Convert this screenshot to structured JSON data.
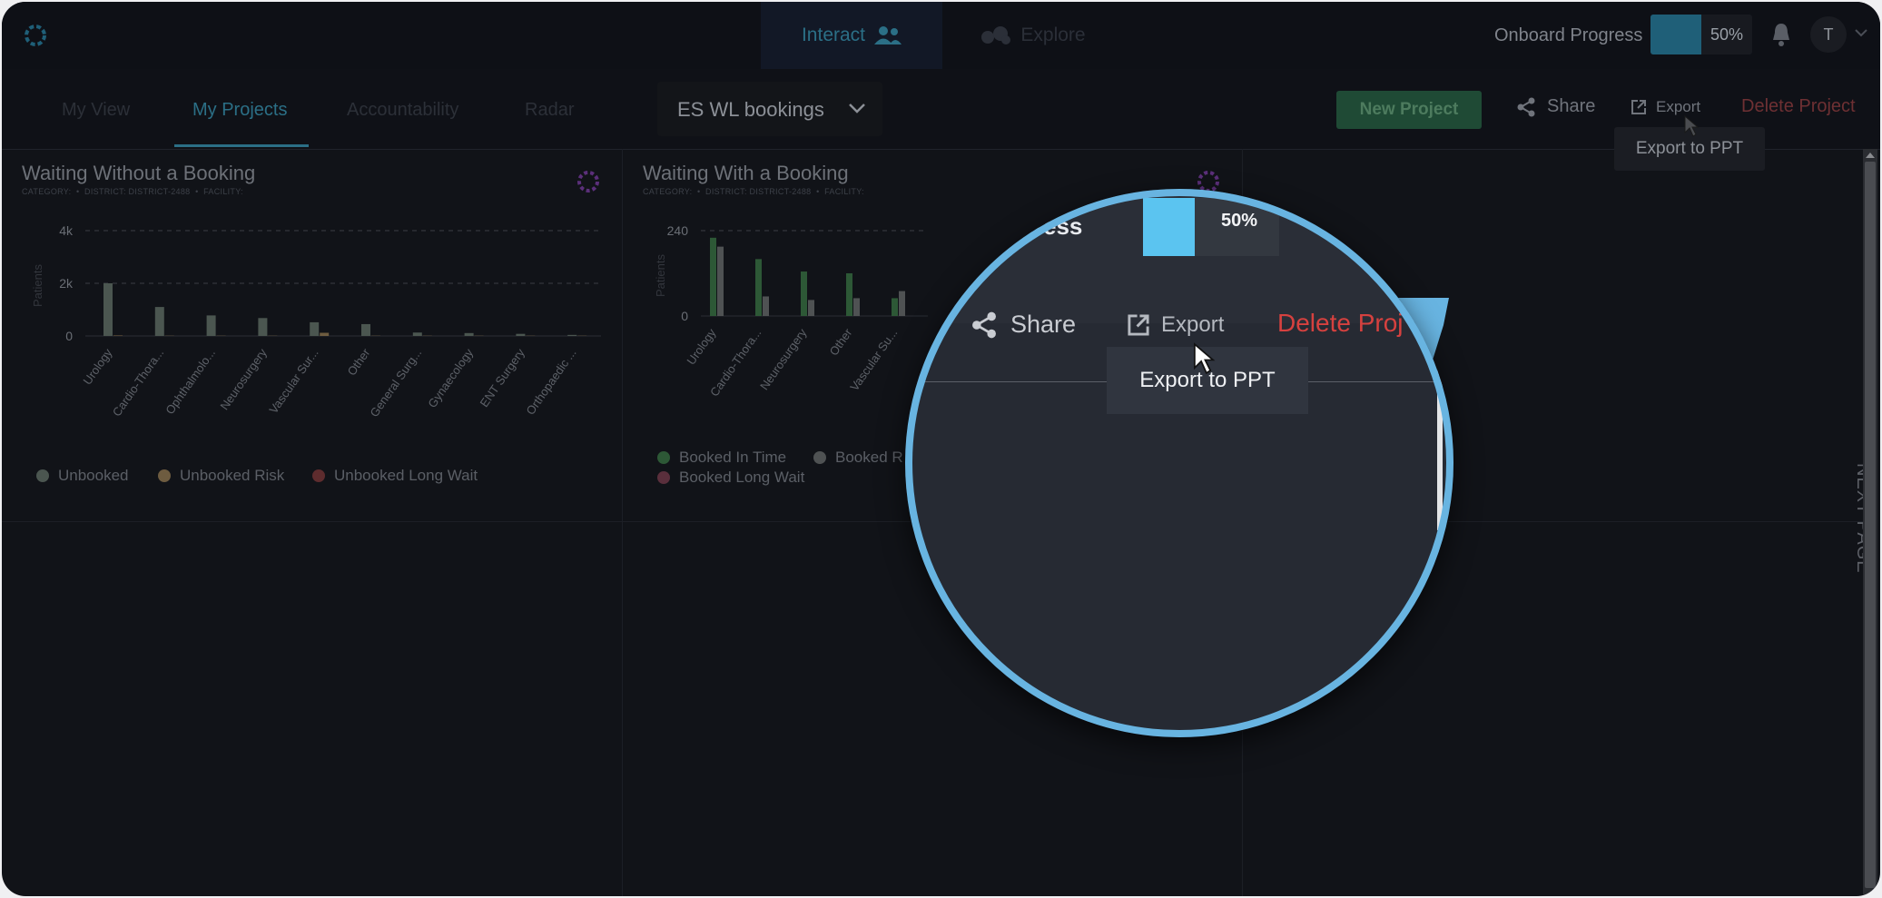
{
  "top_nav": {
    "tabs": [
      {
        "label": "Interact",
        "icon": "users-icon",
        "active": true
      },
      {
        "label": "Explore",
        "icon": "explore-icon",
        "active": false
      }
    ],
    "onboard_progress": {
      "label": "Onboard Progress",
      "value_pct": 50,
      "text": "50%"
    },
    "user_initial": "T"
  },
  "sub_nav": {
    "tabs": [
      "My View",
      "My Projects",
      "Accountability",
      "Radar"
    ],
    "active_tab": "My Projects",
    "project_select": "ES WL bookings",
    "new_project": "New Project",
    "share": "Share",
    "export": "Export",
    "delete": "Delete Project",
    "export_tooltip": "Export to PPT"
  },
  "panels": [
    {
      "title": "Waiting Without a Booking",
      "subtitle": [
        "CATEGORY:",
        "DISTRICT: DISTRICT-2488",
        "FACILITY:"
      ],
      "chart_data": {
        "type": "bar",
        "ylabel": "Patients",
        "yticks": [
          "4k",
          "2k",
          "0"
        ],
        "ylim": [
          0,
          4000
        ],
        "categories": [
          "Urology",
          "Cardio-Thora...",
          "Ophthalmolo...",
          "Neurosurgery",
          "Vascular Sur...",
          "Other",
          "General Surg...",
          "Gynaecology",
          "ENT Surgery",
          "Orthopaedic ..."
        ],
        "series": [
          {
            "name": "Unbooked",
            "color": "#4b5650",
            "values": [
              2000,
              1100,
              780,
              680,
              520,
              450,
              130,
              110,
              80,
              40
            ]
          },
          {
            "name": "Unbooked Risk",
            "color": "#6e5c40",
            "values": [
              20,
              10,
              10,
              10,
              120,
              10,
              10,
              10,
              10,
              10
            ]
          },
          {
            "name": "Unbooked Long Wait",
            "color": "#5e2c2e",
            "values": [
              0,
              0,
              0,
              0,
              0,
              0,
              0,
              0,
              0,
              0
            ]
          }
        ]
      }
    },
    {
      "title": "Waiting With a Booking",
      "subtitle": [
        "CATEGORY:",
        "DISTRICT: DISTRICT-2488",
        "FACILITY:"
      ],
      "chart_data": {
        "type": "bar",
        "ylabel": "Patients",
        "yticks": [
          "240",
          "0"
        ],
        "ylim": [
          0,
          240
        ],
        "categories": [
          "Urology",
          "Cardio-Thora...",
          "Neurosurgery",
          "Other",
          "Vascular Su..."
        ],
        "series": [
          {
            "name": "Booked In Time",
            "color": "#2d5836",
            "values": [
              220,
              160,
              125,
              120,
              50
            ]
          },
          {
            "name": "Booked R",
            "color": "#4f5253",
            "values": [
              195,
              55,
              45,
              50,
              70
            ]
          },
          {
            "name": "Booked Long Wait",
            "color": "#5a2f3c",
            "values": [
              0,
              0,
              0,
              0,
              0
            ]
          }
        ]
      }
    }
  ],
  "next_page": "NEXT PAGE",
  "magnifier": {
    "progress_label": "rogress",
    "progress_text": "50%",
    "share": "Share",
    "export": "Export",
    "delete": "Delete Proj",
    "tooltip": "Export to PPT"
  }
}
